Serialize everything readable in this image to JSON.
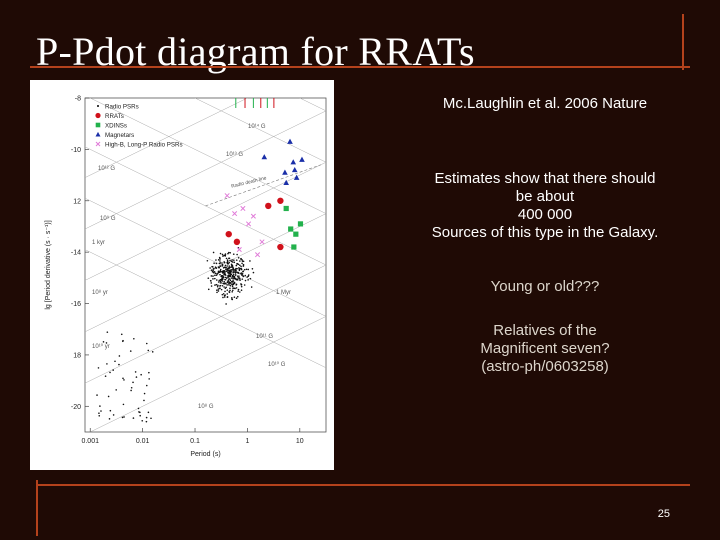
{
  "slide": {
    "title": "P-Pdot diagram for RRATs",
    "citation": "Mc.Laughlin et al. 2006 Nature",
    "estimates_lines": [
      "Estimates show that there should",
      "be about",
      "400 000",
      "Sources of this type in the Galaxy."
    ],
    "question": "Young or old???",
    "relatives_lines": [
      "Relatives of the",
      "Magnificent seven?",
      "(astro-ph/0603258)"
    ],
    "page_number": "25"
  },
  "colors": {
    "background": "#1f0a05",
    "accent_rule": "#b4421c",
    "radio_psr": "#000000",
    "rrat": "#d0111b",
    "xdins": "#22b14c",
    "magnetar": "#1a2fa8",
    "high_b_psr": "#e07ad8"
  },
  "chart_data": {
    "type": "scatter",
    "log_axes": true,
    "xlabel": "Period (s)",
    "ylabel": "lg [Period derivative (s · s⁻¹)]",
    "x_ticks": [
      "0.001",
      "0.01",
      "0.1",
      "1",
      "10"
    ],
    "y_ticks": [
      "-8",
      "-10",
      "12",
      "-14",
      "-16",
      "18",
      "-20"
    ],
    "xlim_log": [
      -3.1,
      1.5
    ],
    "ylim": [
      -21,
      -8
    ],
    "legend_position": "top-left",
    "legend": [
      {
        "label": "Radio PSRs",
        "marker": "dot",
        "color": "#000000"
      },
      {
        "label": "RRATs",
        "marker": "circle",
        "color": "#d0111b"
      },
      {
        "label": "XDINSs",
        "marker": "square",
        "color": "#22b14c"
      },
      {
        "label": "Magnetars",
        "marker": "triangle",
        "color": "#1a2fa8"
      },
      {
        "label": "High-B, Long-P Radio PSRs",
        "marker": "x",
        "color": "#e07ad8"
      }
    ],
    "field_lines": [
      "10¹⁴ G",
      "10¹³ G",
      "10¹² G",
      "10¹¹ G",
      "10¹⁰ G",
      "10⁹ G",
      "10⁸ G"
    ],
    "age_lines": [
      "1 kyr",
      "1 Myr",
      "10⁸ yr",
      "10¹⁰ yr"
    ],
    "death_line_label": "Radio death line",
    "series": [
      {
        "name": "RRATs",
        "marker": "circle",
        "color": "#d0111b",
        "points": [
          [
            0.44,
            -13.3
          ],
          [
            0.63,
            -13.6
          ],
          [
            2.5,
            -12.2
          ],
          [
            4.26,
            -12.0
          ],
          [
            4.26,
            -13.8
          ]
        ]
      },
      {
        "name": "XDINSs",
        "marker": "square",
        "color": "#22b14c",
        "points": [
          [
            5.5,
            -12.3
          ],
          [
            6.7,
            -13.1
          ],
          [
            7.7,
            -13.8
          ],
          [
            8.4,
            -13.3
          ],
          [
            10.3,
            -12.9
          ]
        ]
      },
      {
        "name": "Magnetars",
        "marker": "triangle",
        "color": "#1a2fa8",
        "points": [
          [
            2.1,
            -10.3
          ],
          [
            5.2,
            -10.9
          ],
          [
            5.5,
            -11.3
          ],
          [
            6.5,
            -9.7
          ],
          [
            7.5,
            -10.5
          ],
          [
            8.0,
            -10.8
          ],
          [
            8.7,
            -11.1
          ],
          [
            11.0,
            -10.4
          ]
        ]
      },
      {
        "name": "High-B, Long-P Radio PSRs",
        "marker": "x",
        "color": "#e07ad8",
        "points": [
          [
            0.41,
            -11.8
          ],
          [
            0.57,
            -12.5
          ],
          [
            0.82,
            -12.3
          ],
          [
            1.05,
            -12.9
          ],
          [
            1.3,
            -12.6
          ],
          [
            1.9,
            -13.6
          ],
          [
            0.7,
            -13.9
          ],
          [
            1.56,
            -14.1
          ]
        ]
      }
    ]
  }
}
